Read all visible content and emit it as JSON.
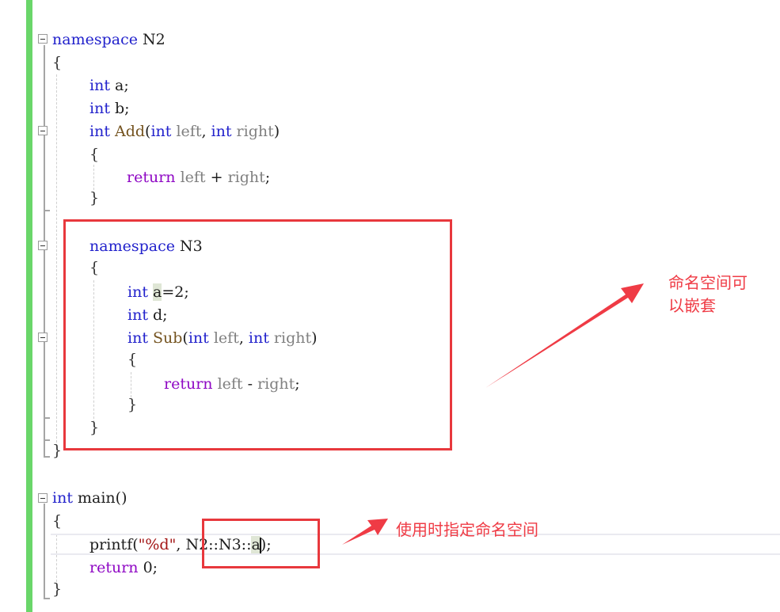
{
  "editor": {
    "lines": {
      "ns2_kw": "namespace",
      "ns2_name": " N2",
      "open1": "{",
      "int_a_kw": "int",
      "int_a_rest": " a;",
      "int_b_kw": "int",
      "int_b_rest": " b;",
      "add_int": "int",
      "add_name": " Add",
      "add_paren": "(",
      "add_p1_kw": "int",
      "add_p1": " left",
      "add_comma": ", ",
      "add_p2_kw": "int",
      "add_p2": " right",
      "add_close": ")",
      "add_open": "{",
      "add_ret": "return",
      "add_body_left": " left",
      "add_op": " + ",
      "add_body_right": "right",
      "add_semi": ";",
      "add_end": "}",
      "ns3_kw": "namespace",
      "ns3_name": " N3",
      "ns3_open": "{",
      "n3_int_a_kw": "int",
      "n3_a_var": "a",
      "n3_a_rest": "=2;",
      "n3_int_d_kw": "int",
      "n3_d_rest": " d;",
      "sub_int": "int",
      "sub_name": " Sub",
      "sub_paren": "(",
      "sub_p1_kw": "int",
      "sub_p1": " left",
      "sub_comma": ", ",
      "sub_p2_kw": "int",
      "sub_p2": " right",
      "sub_close": ")",
      "sub_open": "{",
      "sub_ret": "return",
      "sub_body_left": " left",
      "sub_op": " - ",
      "sub_body_right": "right",
      "sub_semi": ";",
      "sub_end": "}",
      "ns3_close": "}",
      "ns2_close": "}",
      "main_int": "int",
      "main_rest": " main()",
      "main_open": "{",
      "printf_fn": "printf(",
      "printf_str": "\"%d\"",
      "printf_comma": ", ",
      "printf_scope": "N2::N3::",
      "printf_var": "a",
      "printf_end": ");",
      "return_kw": "return",
      "return_val": " 0;",
      "main_close": "}"
    }
  },
  "annotations": {
    "nested_note_line1": "命名空间可",
    "nested_note_line2": "以嵌套",
    "usage_note": "使用时指定命名空间"
  },
  "colors": {
    "annotation_red": "#e8383d",
    "keyword_blue": "#2222cc",
    "return_purple": "#8f08c4",
    "change_bar_green": "#6ad66a"
  }
}
